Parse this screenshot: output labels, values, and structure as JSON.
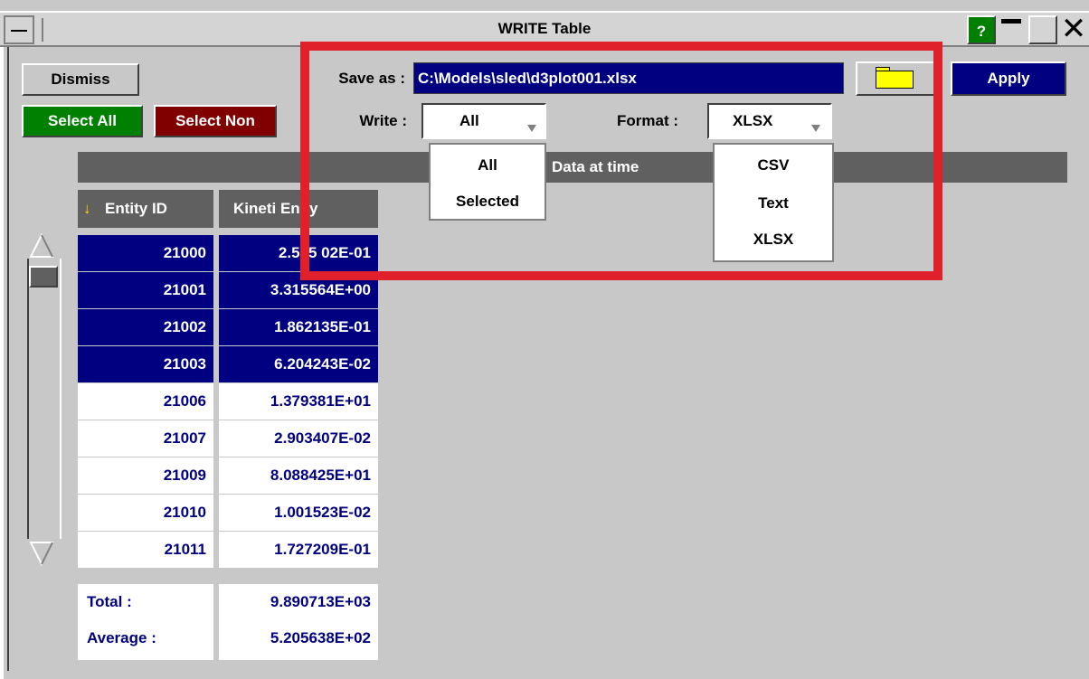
{
  "window": {
    "title": "WRITE Table",
    "help_label": "?"
  },
  "toolbar": {
    "dismiss_label": "Dismiss",
    "select_all_label": "Select All",
    "select_none_label": "Select Non",
    "apply_label": "Apply"
  },
  "save": {
    "label": "Save as :",
    "value": "C:\\Models\\sled\\d3plot001.xlsx"
  },
  "write": {
    "label": "Write :",
    "selected": "All",
    "options": [
      "All",
      "Selected"
    ]
  },
  "format": {
    "label": "Format :",
    "selected": "XLSX",
    "options": [
      "CSV",
      "Text",
      "XLSX"
    ]
  },
  "data_header": "Data at time",
  "table": {
    "columns": [
      "Entity ID",
      "Kineti Engy"
    ],
    "rows": [
      {
        "id": "21000",
        "value": "2.525 02E-01",
        "selected": true
      },
      {
        "id": "21001",
        "value": "3.315564E+00",
        "selected": true
      },
      {
        "id": "21002",
        "value": "1.862135E-01",
        "selected": true
      },
      {
        "id": "21003",
        "value": "6.204243E-02",
        "selected": true
      },
      {
        "id": "21006",
        "value": "1.379381E+01",
        "selected": false
      },
      {
        "id": "21007",
        "value": "2.903407E-02",
        "selected": false
      },
      {
        "id": "21009",
        "value": "8.088425E+01",
        "selected": false
      },
      {
        "id": "21010",
        "value": "1.001523E-02",
        "selected": false
      },
      {
        "id": "21011",
        "value": "1.727209E-01",
        "selected": false
      }
    ],
    "total_label": "Total :",
    "total_value": "9.890713E+03",
    "average_label": "Average :",
    "average_value": "5.205638E+02"
  },
  "colors": {
    "selected_row": "#000080",
    "highlight": "#e0202a",
    "select_all": "#008000",
    "select_none": "#800000"
  }
}
